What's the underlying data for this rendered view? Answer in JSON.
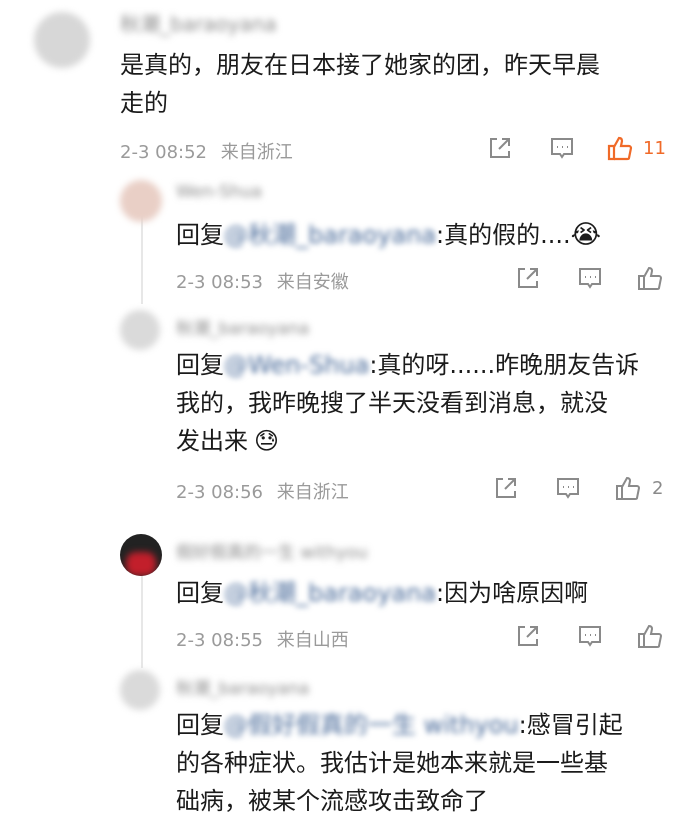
{
  "main_comment": {
    "username": "秋潮_baraoyana",
    "text_line1": "是真的，朋友在日本接了她家的团，昨天早晨",
    "text_line2": "走的",
    "date": "2-3 08:52",
    "location": "来自浙江",
    "like_count": "11"
  },
  "replies": [
    {
      "username": "Wen-Shua",
      "reply_prefix": "回复",
      "mention": "@秋潮_baraoyana",
      "text_line1": ":真的假的....",
      "emoji": "😭",
      "date": "2-3 08:53",
      "location": "来自安徽",
      "like_count": ""
    },
    {
      "username": "秋潮_baraoyana",
      "reply_prefix": "回复",
      "mention": "@Wen-Shua",
      "text_line1": ":真的呀......昨晚朋友告诉",
      "text_line2": "我的，我昨晚搜了半天没看到消息，就没",
      "text_line3": "发出来",
      "emoji": "😓",
      "date": "2-3 08:56",
      "location": "来自浙江",
      "like_count": "2"
    },
    {
      "username": "假好假真的一生 withyou",
      "reply_prefix": "回复",
      "mention": "@秋潮_baraoyana",
      "text_line1": ":因为啥原因啊",
      "date": "2-3 08:55",
      "location": "来自山西",
      "like_count": ""
    },
    {
      "username": "秋潮_baraoyana",
      "reply_prefix": "回复",
      "mention": "@假好假真的一生 withyou",
      "text_line1": ":感冒引起",
      "text_line2": "的各种症状。我估计是她本来就是一些基",
      "text_line3": "础病，被某个流感攻击致命了",
      "date": "",
      "location": "",
      "like_count": ""
    }
  ],
  "colors": {
    "like_active": "#f06a28",
    "mention": "#4a6b9a",
    "meta": "#9a9a9a",
    "icon": "#8a8a8a"
  }
}
